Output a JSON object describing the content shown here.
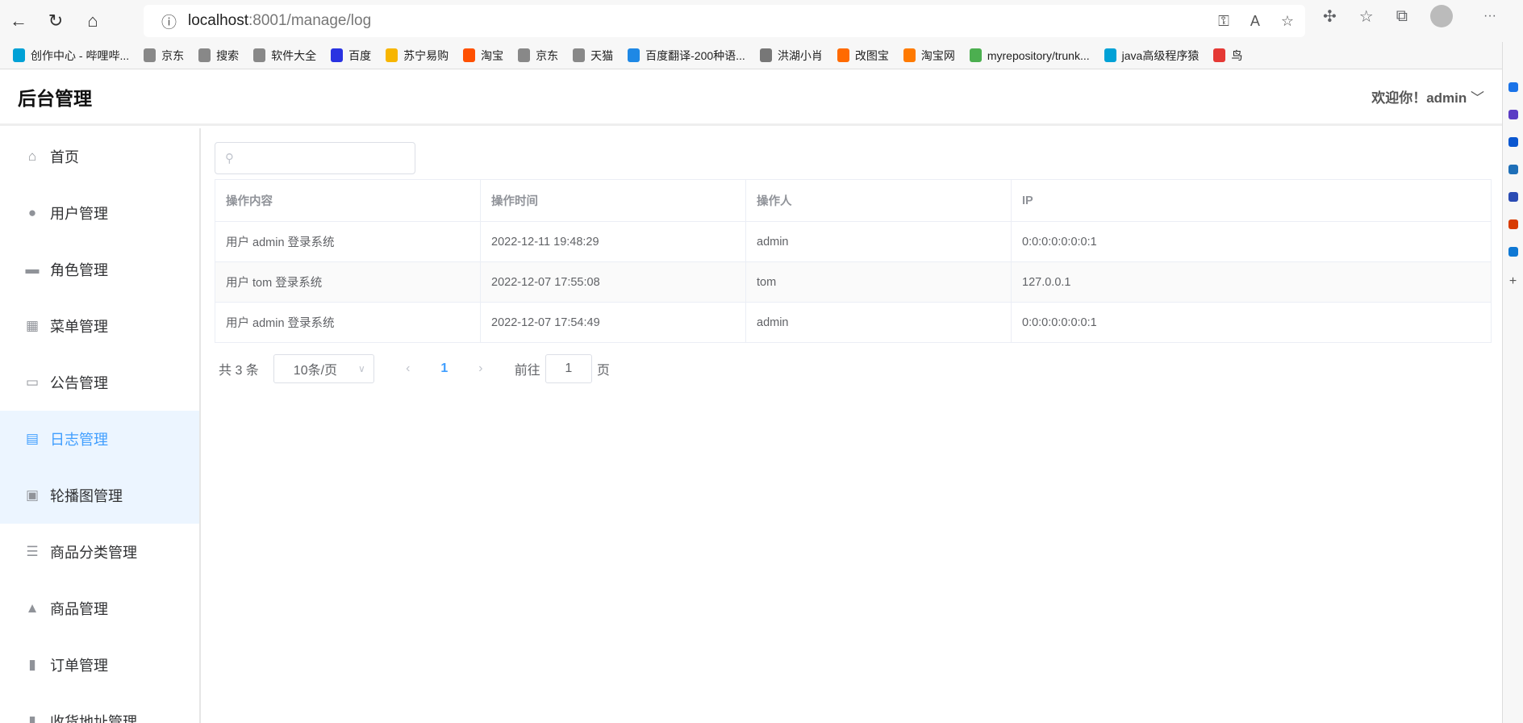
{
  "browser": {
    "url_host": "localhost",
    "url_path": ":8001/manage/log",
    "bookmarks": [
      "创作中心 - 哔哩哔...",
      "京东",
      "搜索",
      "软件大全",
      "百度",
      "苏宁易购",
      "淘宝",
      "京东",
      "天猫",
      "百度翻译-200种语...",
      "洪湖小肖",
      "改图宝",
      "淘宝网",
      "myrepository/trunk...",
      "java高级程序猿",
      "鸟"
    ],
    "bookmark_colors": [
      "#00a1d6",
      "#888",
      "#888",
      "#888",
      "#2932e1",
      "#f7b500",
      "#ff5000",
      "#888",
      "#888",
      "#1e88e5",
      "#777",
      "#ff6a00",
      "#ff7a00",
      "#4caf50",
      "#00a1d6",
      "#e53935"
    ]
  },
  "header": {
    "title": "后台管理",
    "welcome": "欢迎你！admin"
  },
  "sidebar": {
    "items": [
      {
        "label": "首页",
        "icon": "⌂"
      },
      {
        "label": "用户管理",
        "icon": "●"
      },
      {
        "label": "角色管理",
        "icon": "▬"
      },
      {
        "label": "菜单管理",
        "icon": "▦"
      },
      {
        "label": "公告管理",
        "icon": "▭"
      },
      {
        "label": "日志管理",
        "icon": "▤"
      },
      {
        "label": "轮播图管理",
        "icon": "▣"
      },
      {
        "label": "商品分类管理",
        "icon": "☰"
      },
      {
        "label": "商品管理",
        "icon": "▲"
      },
      {
        "label": "订单管理",
        "icon": "▮"
      },
      {
        "label": "收货地址管理",
        "icon": "▮"
      }
    ]
  },
  "search": {
    "placeholder": ""
  },
  "table": {
    "headers": [
      "操作内容",
      "操作时间",
      "操作人",
      "IP"
    ],
    "rows": [
      [
        "用户 admin 登录系统",
        "2022-12-11 19:48:29",
        "admin",
        "0:0:0:0:0:0:0:1"
      ],
      [
        "用户 tom 登录系统",
        "2022-12-07 17:55:08",
        "tom",
        "127.0.0.1"
      ],
      [
        "用户 admin 登录系统",
        "2022-12-07 17:54:49",
        "admin",
        "0:0:0:0:0:0:0:1"
      ]
    ]
  },
  "pagination": {
    "total": "共 3 条",
    "page_size": "10条/页",
    "current": "1",
    "goto_label": "前往",
    "goto_value": "1",
    "page_suffix": "页"
  }
}
